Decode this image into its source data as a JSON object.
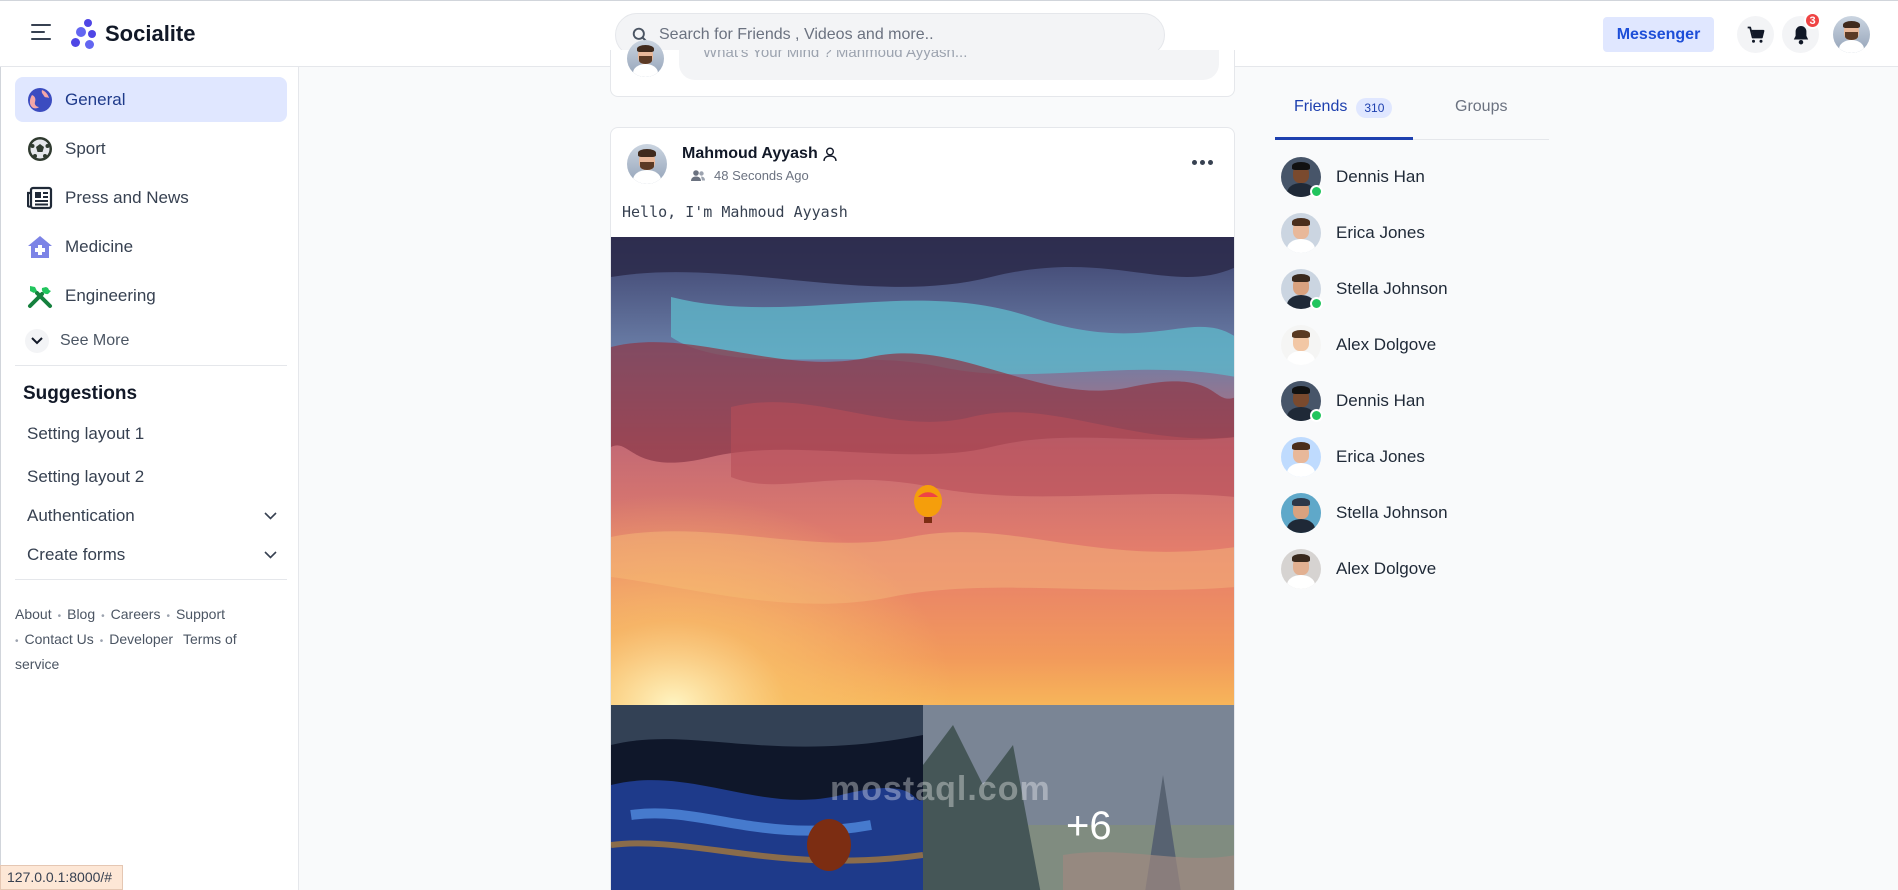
{
  "header": {
    "brand": "Socialite",
    "search_placeholder": "Search for Friends , Videos and more..",
    "messenger_label": "Messenger",
    "notification_count": "3"
  },
  "sidebar": {
    "items": [
      {
        "label": "General",
        "icon": "globe-icon"
      },
      {
        "label": "Sport",
        "icon": "soccer-ball-icon"
      },
      {
        "label": "Press and News",
        "icon": "newspaper-icon"
      },
      {
        "label": "Medicine",
        "icon": "medical-house-icon"
      },
      {
        "label": "Engineering",
        "icon": "tools-icon"
      }
    ],
    "see_more": "See More",
    "suggestions_title": "Suggestions",
    "suggestions": [
      {
        "label": "Setting layout 1"
      },
      {
        "label": "Setting layout 2"
      },
      {
        "label": "Authentication"
      },
      {
        "label": "Create forms"
      }
    ],
    "footer_links": [
      "About",
      "Blog",
      "Careers",
      "Support",
      "Contact Us",
      "Developer",
      "Terms of service"
    ]
  },
  "status_bar_url": "127.0.0.1:8000/#",
  "composer": {
    "placeholder": "What's Your Mind ? Mahmoud Ayyash..."
  },
  "post": {
    "author": "Mahmoud Ayyash",
    "time": "48 Seconds Ago",
    "text": "Hello, I'm Mahmoud Ayyash",
    "more_media_count": "+6"
  },
  "watermark": "mostaql.com",
  "friends_panel": {
    "tab_friends": "Friends",
    "friends_count": "310",
    "tab_groups": "Groups",
    "friends": [
      {
        "name": "Dennis Han",
        "online": true
      },
      {
        "name": "Erica Jones",
        "online": false
      },
      {
        "name": "Stella Johnson",
        "online": true
      },
      {
        "name": "Alex Dolgove",
        "online": false
      },
      {
        "name": "Dennis Han",
        "online": true
      },
      {
        "name": "Erica Jones",
        "online": false
      },
      {
        "name": "Stella Johnson",
        "online": false
      },
      {
        "name": "Alex Dolgove",
        "online": false
      }
    ]
  },
  "colors": {
    "accent": "#1e40af",
    "active_bg": "#e0e7ff",
    "online": "#22c55e",
    "badge": "#ef4444"
  }
}
